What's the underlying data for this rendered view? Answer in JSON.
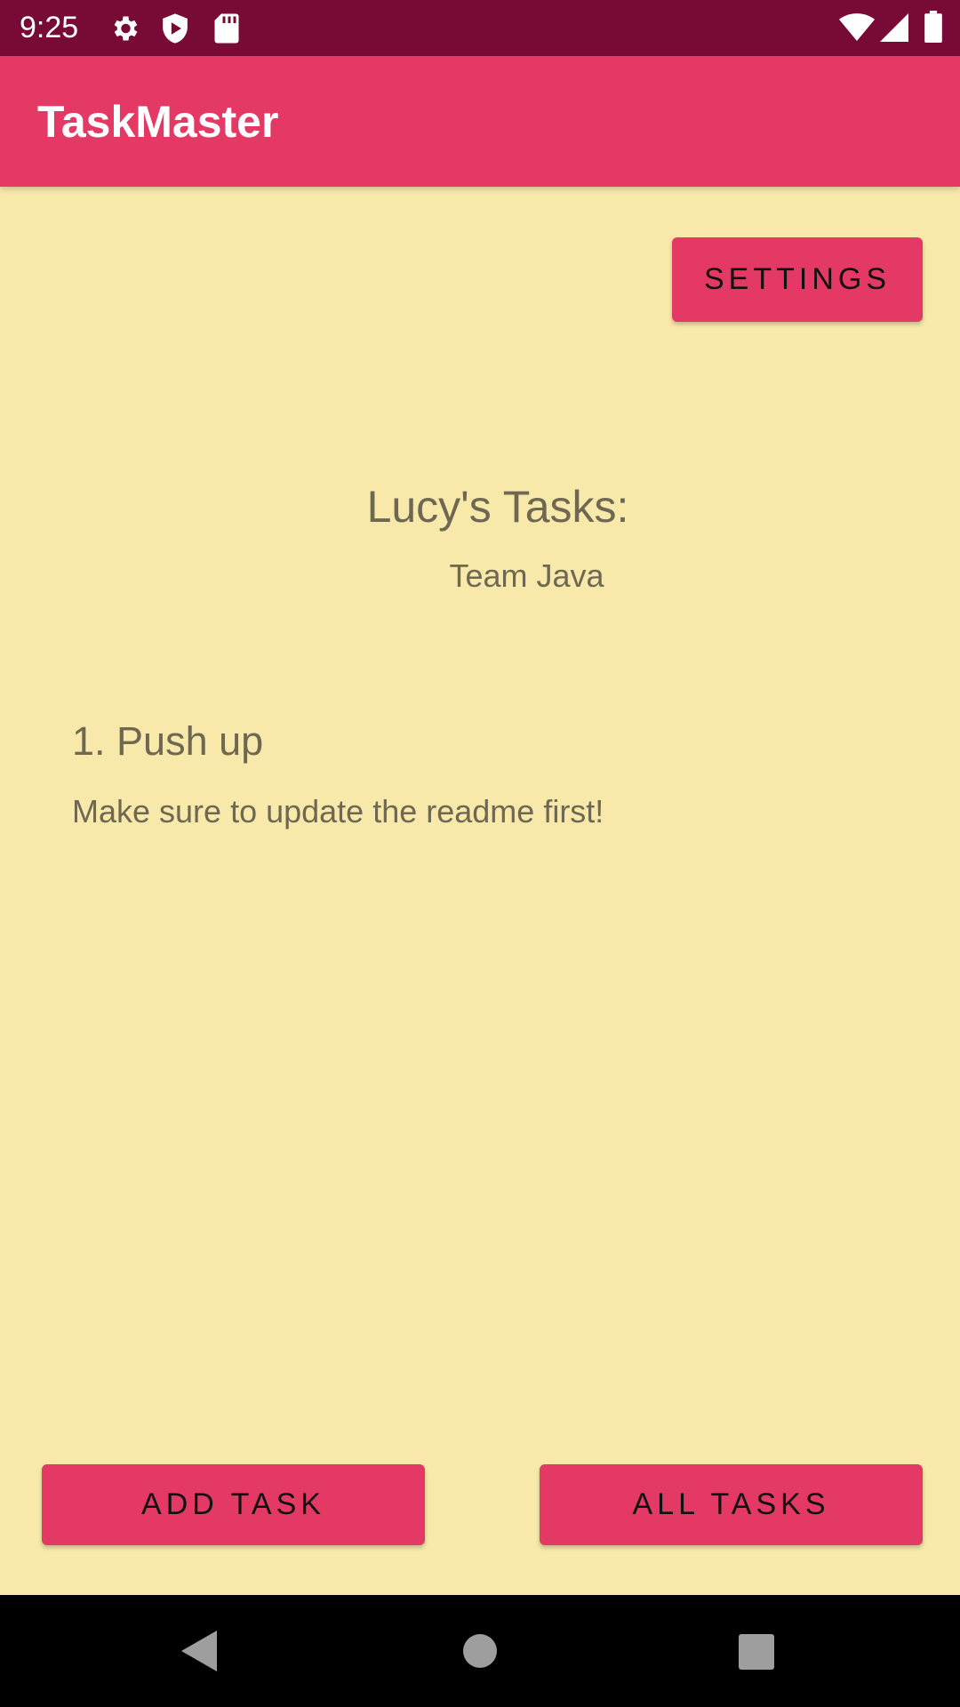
{
  "status_bar": {
    "time": "9:25",
    "icons": [
      "gear-icon",
      "shield-icon",
      "sd-card-icon",
      "wifi-icon",
      "signal-icon",
      "battery-icon"
    ]
  },
  "app_bar": {
    "title": "TaskMaster"
  },
  "settings_button": {
    "label": "SETTINGS"
  },
  "tasks_heading": "Lucy's Tasks:",
  "team_name": "Team Java",
  "tasks": [
    {
      "number": "1.",
      "title": "Push up",
      "body": "Make sure to update the readme first!"
    }
  ],
  "bottom_buttons": {
    "add_task": "ADD TASK",
    "all_tasks": "ALL TASKS"
  },
  "nav_bar": {
    "icons": [
      "back-icon",
      "home-icon",
      "recents-icon"
    ]
  },
  "colors": {
    "status_bar": "#780A36",
    "primary": "#E33964",
    "background": "#F8E9AB",
    "text": "#6E6852"
  }
}
